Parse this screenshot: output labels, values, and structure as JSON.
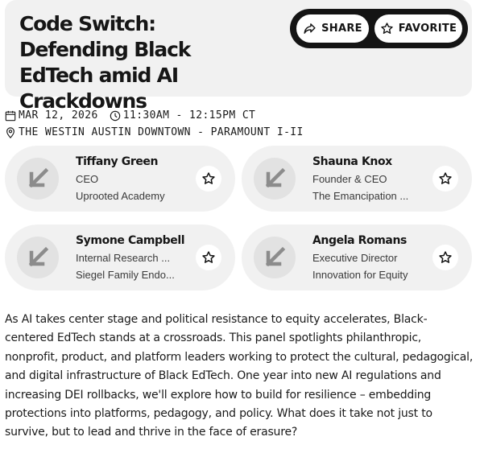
{
  "session": {
    "title": "Code Switch: Defending Black EdTech amid AI Crackdowns",
    "date": "MAR 12, 2026",
    "time": "11:30AM - 12:15PM CT",
    "location": "THE WESTIN AUSTIN DOWNTOWN - PARAMOUNT I-II",
    "description": "As AI takes center stage and political resistance to equity accelerates, Black-centered EdTech stands at a crossroads. This panel spotlights philanthropic, nonprofit, product, and platform leaders working to protect the cultural, pedagogical, and digital infrastructure of Black EdTech. One year into new AI regulations and increasing DEI rollbacks, we'll explore how to build for resilience – embedding protections into platforms, pedagogy, and policy. What does it take not just to survive, but to lead and thrive in the face of erasure?"
  },
  "actions": {
    "share_label": "SHARE",
    "favorite_label": "FAVORITE",
    "share_icon": "share-arrow-icon",
    "favorite_icon": "star-outline-icon"
  },
  "icons": {
    "date": "calendar-icon",
    "time": "clock-icon",
    "location": "map-pin-icon",
    "avatar": "arrow-down-left-icon",
    "favorite": "star-outline-icon"
  },
  "speakers": [
    {
      "name": "Tiffany Green",
      "role": "CEO",
      "org": "Uprooted Academy"
    },
    {
      "name": "Shauna Knox",
      "role": "Founder & CEO",
      "org": "The Emancipation ..."
    },
    {
      "name": "Symone Campbell",
      "role": "Internal Research ...",
      "org": "Siegel Family Endo..."
    },
    {
      "name": "Angela Romans",
      "role": "Executive Director",
      "org": "Innovation for Equity"
    }
  ],
  "colors": {
    "card_bg": "#f1f1f1",
    "pill_bg": "#141414",
    "avatar_bg": "#e2e2e2",
    "avatar_arrow": "#8c8c8c",
    "text": "#1a1a1a"
  }
}
